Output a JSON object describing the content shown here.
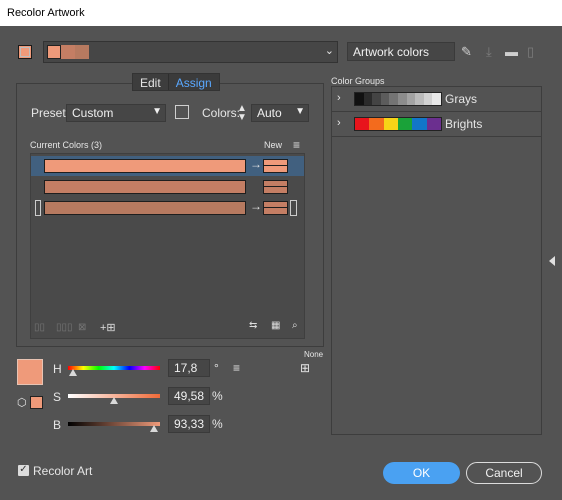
{
  "window": {
    "title": "Recolor Artwork"
  },
  "top": {
    "artwork_name": "Artwork colors",
    "icons": [
      "eyedropper-icon",
      "save-icon",
      "folder-icon",
      "trash-icon"
    ]
  },
  "tabs": [
    {
      "label": "Edit"
    },
    {
      "label": "Assign"
    }
  ],
  "active_tab": "Assign",
  "preset": {
    "label": "Preset:",
    "value": "Custom"
  },
  "colors": {
    "label": "Colors:",
    "value": "Auto"
  },
  "current_colors": {
    "header": "Current Colors (3)",
    "new_header": "New",
    "rows": [
      {
        "current": "#ef9a7a",
        "new": "#ef9a7a",
        "selected": true
      },
      {
        "current": "#c47e64",
        "new": "#c47e64",
        "selected": false
      },
      {
        "current": "#b77a60",
        "new": "#c47e64",
        "selected": false
      }
    ]
  },
  "hsb": {
    "h_label": "H",
    "h_value": "17,8",
    "h_unit": "°",
    "s_label": "S",
    "s_value": "49,58",
    "s_unit": "%",
    "b_label": "B",
    "b_value": "93,33",
    "b_unit": "%",
    "h_pos": 0.05,
    "s_pos": 0.5,
    "b_pos": 0.93
  },
  "none_label": "None",
  "color_groups": {
    "title": "Color Groups",
    "groups": [
      {
        "name": "Grays",
        "swatches": [
          "#111111",
          "#2b2b2b",
          "#444444",
          "#5c5c5c",
          "#747474",
          "#8c8c8c",
          "#a3a3a3",
          "#bbbbbb",
          "#d2d2d2",
          "#e9e9e9"
        ]
      },
      {
        "name": "Brights",
        "swatches": [
          "#e8141c",
          "#f36b1d",
          "#f7d417",
          "#1aa239",
          "#1276c9",
          "#6b2f8f"
        ]
      }
    ]
  },
  "footer": {
    "recolor_label": "Recolor Art",
    "recolor_checked": true,
    "ok_label": "OK",
    "cancel_label": "Cancel"
  }
}
